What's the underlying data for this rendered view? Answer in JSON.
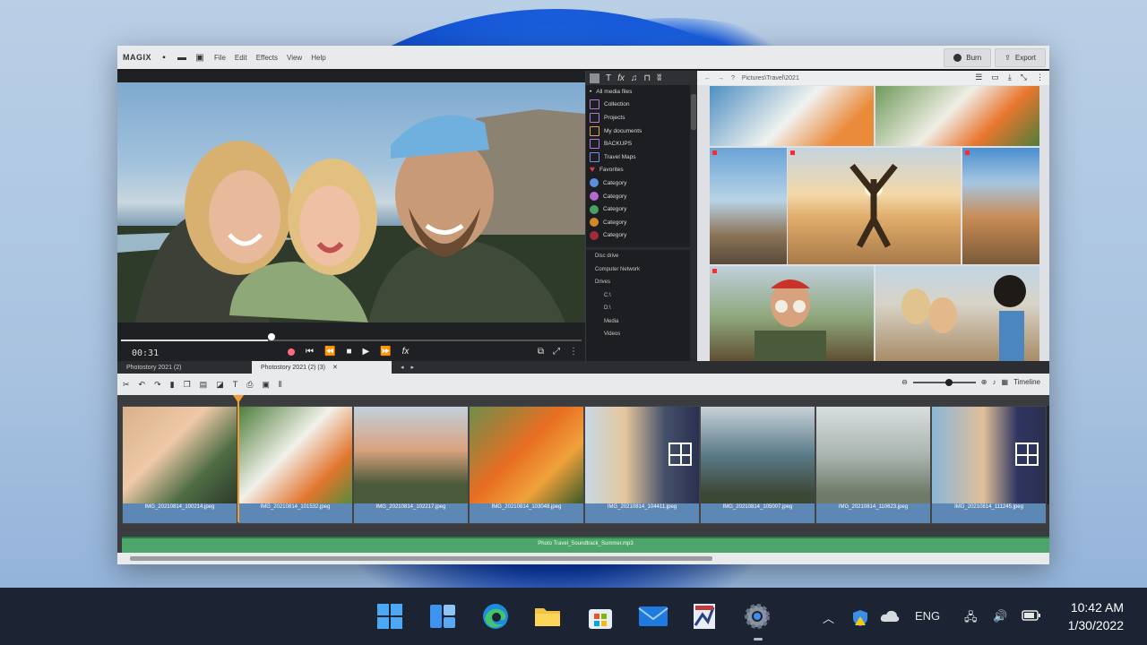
{
  "app": {
    "logo": "MAGIX",
    "menus": [
      "File",
      "Edit",
      "Effects",
      "View",
      "Help"
    ],
    "top_buttons": {
      "burn": "Burn",
      "export": "Export"
    }
  },
  "preview": {
    "timecode": "00:31",
    "scrub_position": 0.32
  },
  "media_pool": {
    "items": [
      {
        "label": "All media files",
        "icon": "bullet-icon",
        "color": "#ffffff"
      },
      {
        "label": "Collection",
        "icon": "collection-icon",
        "color": "#b07ad8"
      },
      {
        "label": "Projects",
        "icon": "projects-icon",
        "color": "#b07ad8"
      },
      {
        "label": "My documents",
        "icon": "folder-icon",
        "color": "#e0a050"
      },
      {
        "label": "BACKUPS",
        "icon": "backup-icon",
        "color": "#b07ad8"
      },
      {
        "label": "Travel Maps",
        "icon": "map-icon",
        "color": "#7a8ae8"
      },
      {
        "label": "Favorites",
        "icon": "heart-icon",
        "color": "#e23a4a"
      },
      {
        "label": "Category",
        "icon": "category-icon",
        "color": "#5a8fe0"
      },
      {
        "label": "Category",
        "icon": "category-icon",
        "color": "#b06ad0"
      },
      {
        "label": "Category",
        "icon": "category-icon",
        "color": "#4aa060"
      },
      {
        "label": "Category",
        "icon": "category-icon",
        "color": "#d08a2a"
      },
      {
        "label": "Category",
        "icon": "category-icon",
        "color": "#a02a3a"
      }
    ],
    "tree": [
      "Disc drive",
      "Computer Network",
      "Drives",
      "C:\\",
      "D:\\",
      "Media",
      "Videos"
    ]
  },
  "grid": {
    "path": "Pictures\\Travel\\2021"
  },
  "timeline": {
    "tabs": [
      {
        "label": "Photostory 2021 (2)",
        "active": false
      },
      {
        "label": "Photostory 2021 (2) (3)",
        "active": true
      }
    ],
    "clips": [
      {
        "label": "IMG_20210814_100214.jpeg"
      },
      {
        "label": "IMG_20210814_101532.jpeg"
      },
      {
        "label": "IMG_20210814_102217.jpeg"
      },
      {
        "label": "IMG_20210814_103048.jpeg"
      },
      {
        "label": "IMG_20210814_104411.jpeg"
      },
      {
        "label": "IMG_20210814_105007.jpeg"
      },
      {
        "label": "IMG_20210814_110623.jpeg"
      },
      {
        "label": "IMG_20210814_111245.jpeg"
      }
    ],
    "audio_label": "Photo Travel_Soundtrack_Summer.mp3",
    "zoom_label": "Timeline"
  },
  "taskbar": {
    "apps": [
      "windows-start-icon",
      "widgets-icon",
      "edge-icon",
      "file-explorer-icon",
      "store-icon",
      "mail-icon",
      "photos-icon",
      "settings-icon"
    ],
    "tray": {
      "lang": "ENG"
    },
    "time": "10:42 AM",
    "date": "1/30/2022"
  },
  "colors": {
    "accent_play": "#f0a030",
    "clip_label": "#5d87b4",
    "audio": "#4da56b"
  }
}
